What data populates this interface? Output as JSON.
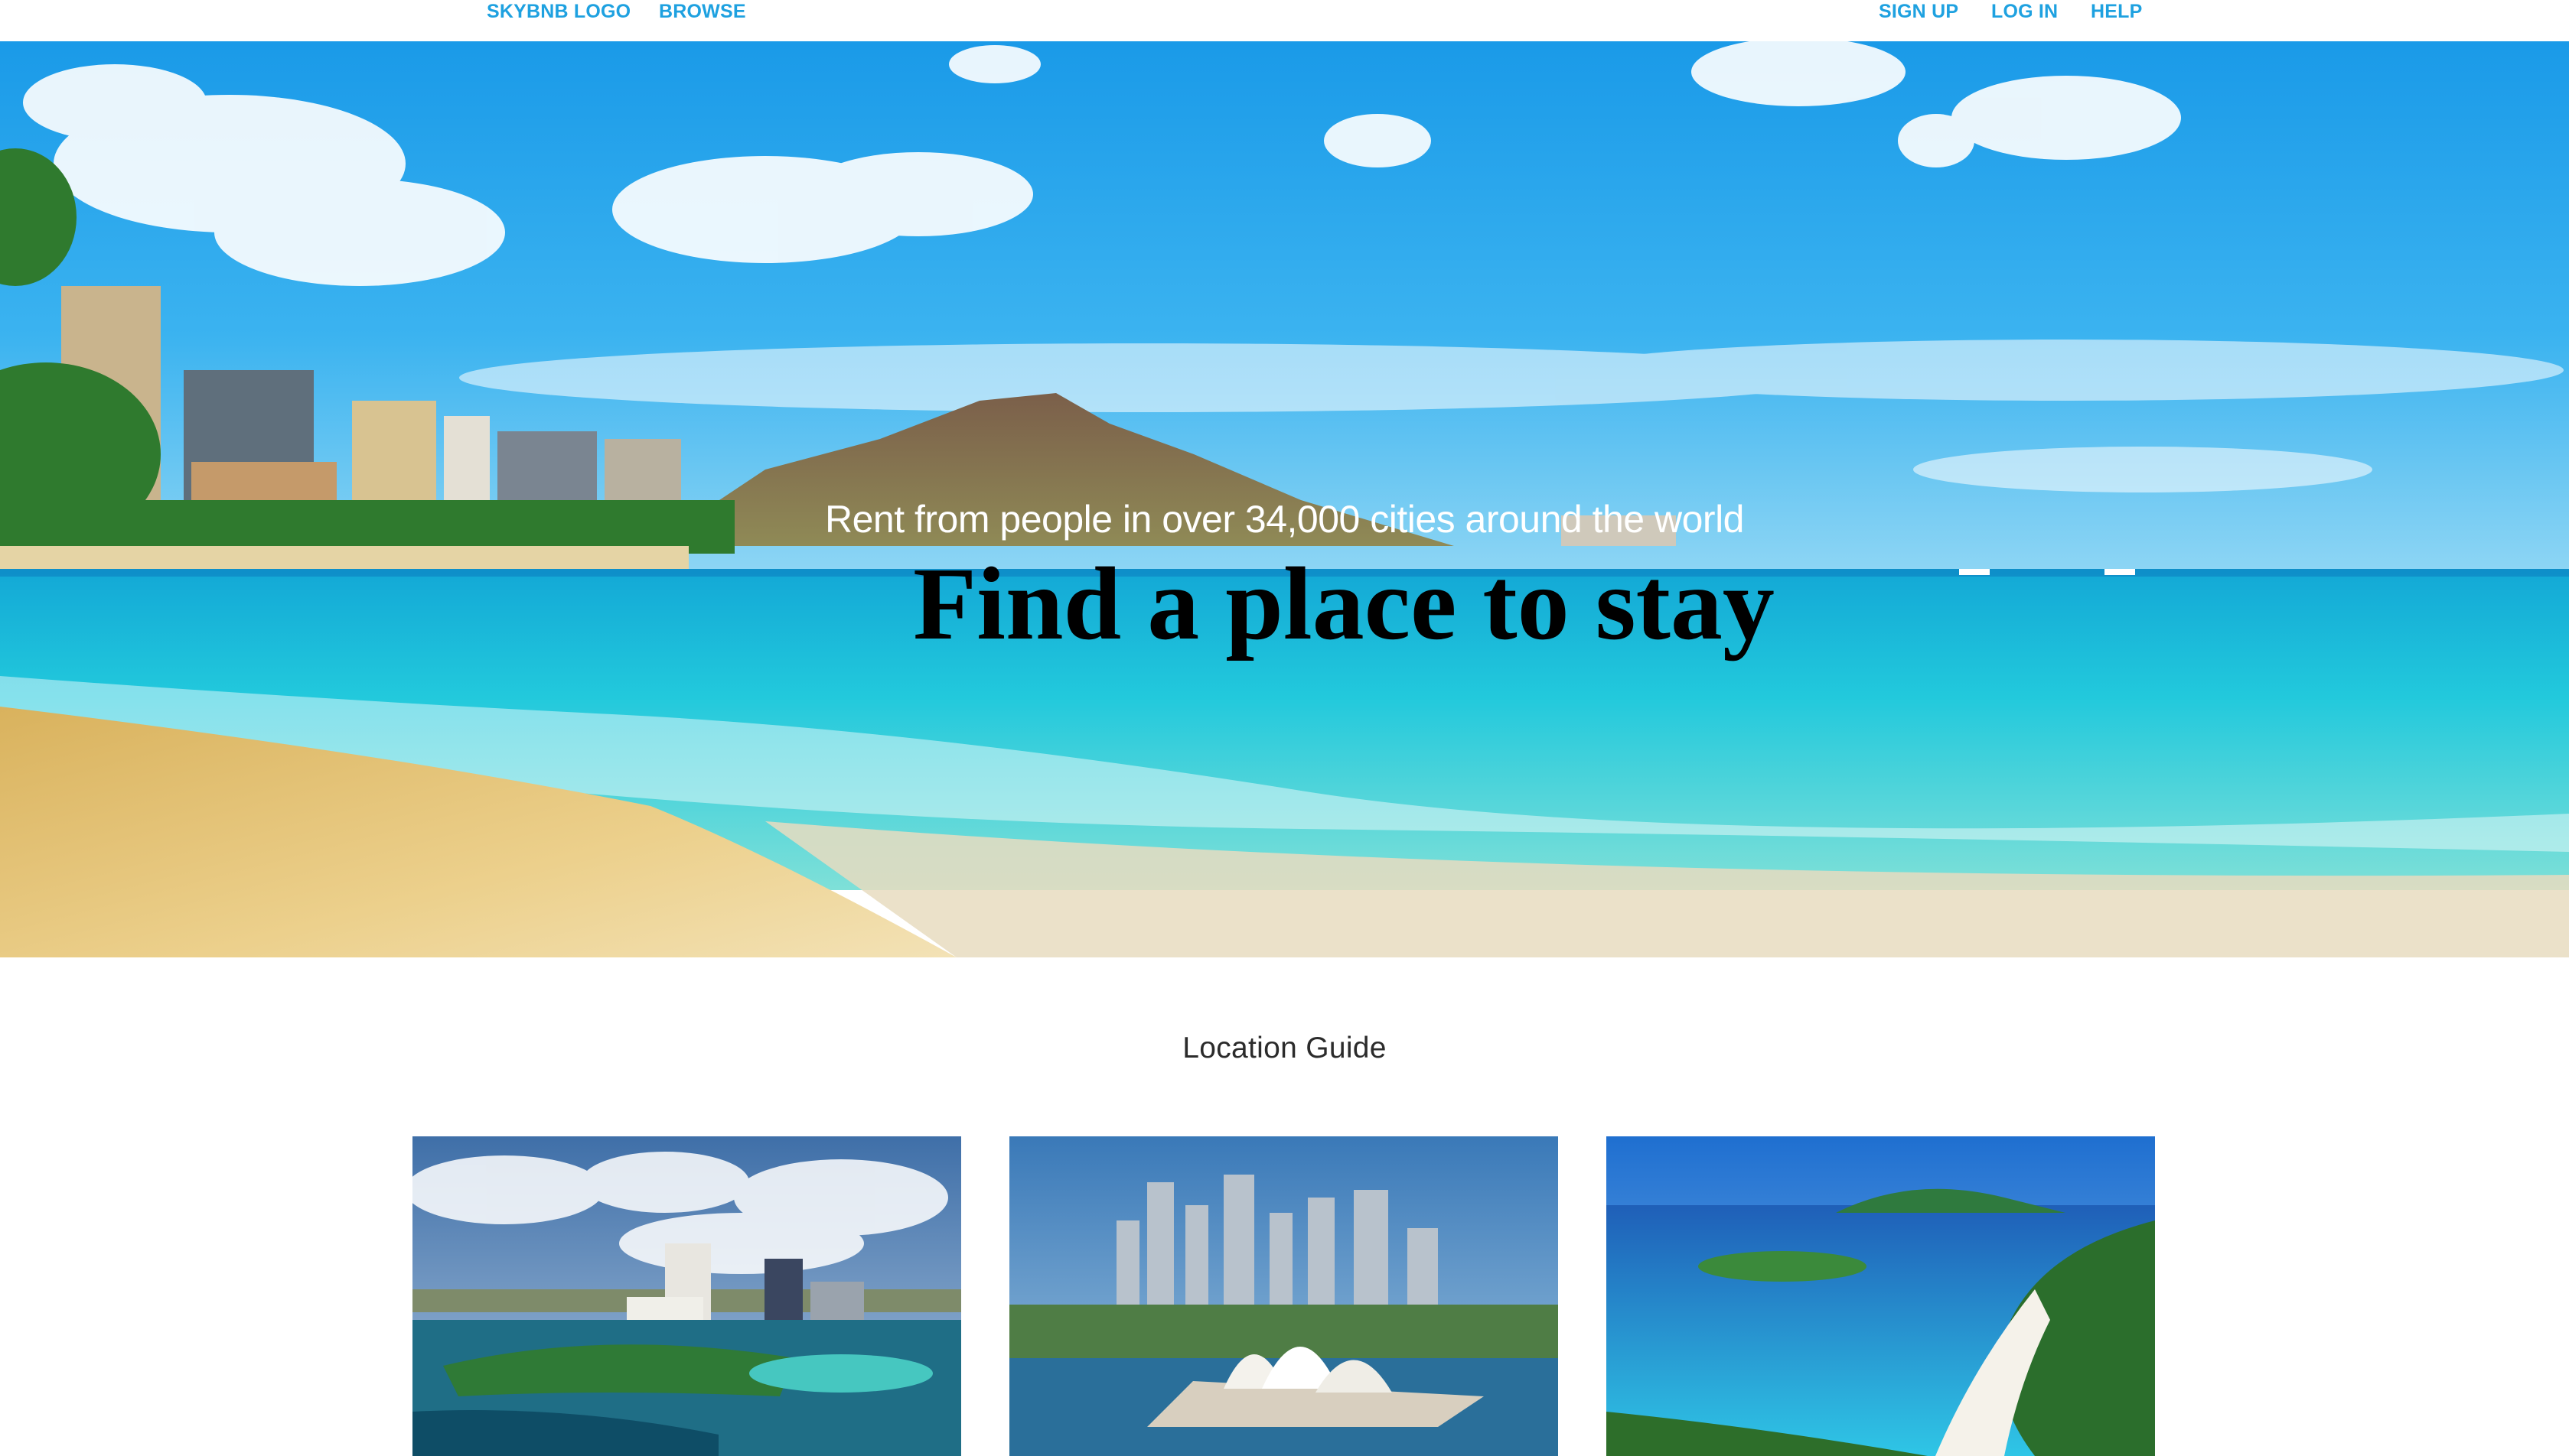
{
  "nav": {
    "logo": "SKYBNB LOGO",
    "browse": "BROWSE",
    "sign_up": "SIGN UP",
    "log_in": "LOG IN",
    "help": "HELP"
  },
  "hero": {
    "subtitle": "Rent from people in over 34,000 cities around the world",
    "title": "Find a place to stay"
  },
  "location_guide": {
    "title": "Location Guide"
  },
  "colors": {
    "nav_link": "#1ea1e0",
    "sky": "#2aa6ea",
    "sea": "#1fc3d8",
    "sand": "#e8c97a"
  }
}
